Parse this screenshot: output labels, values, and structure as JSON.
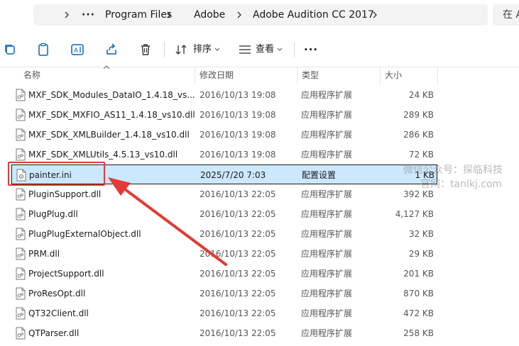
{
  "address": {
    "breadcrumb": [
      "Program Files",
      "Adobe",
      "Adobe Audition CC 2017"
    ],
    "more_glyph": "···",
    "search_placeholder": "在 A"
  },
  "toolbar": {
    "sort_label": "排序",
    "view_label": "查看",
    "more_glyph": "···"
  },
  "columns": {
    "name": "名称",
    "date": "修改日期",
    "type": "类型",
    "size": "大小"
  },
  "files": [
    {
      "name": "MXF_SDK_Modules_DataIO_1.4.18_vs...",
      "date": "2016/10/13 19:08",
      "type": "应用程序扩展",
      "size": "24 KB",
      "icon": "dll-file-icon"
    },
    {
      "name": "MXF_SDK_MXFIO_AS11_1.4.18_vs10.dll",
      "date": "2016/10/13 19:08",
      "type": "应用程序扩展",
      "size": "289 KB",
      "icon": "dll-file-icon"
    },
    {
      "name": "MXF_SDK_XMLBuilder_1.4.18_vs10.dll",
      "date": "2016/10/13 19:08",
      "type": "应用程序扩展",
      "size": "286 KB",
      "icon": "dll-file-icon"
    },
    {
      "name": "MXF_SDK_XMLUtils_4.5.13_vs10.dll",
      "date": "2016/10/13 19:08",
      "type": "应用程序扩展",
      "size": "72 KB",
      "icon": "dll-file-icon"
    },
    {
      "name": "painter.ini",
      "date": "2025/7/20 7:03",
      "type": "配置设置",
      "size": "1 KB",
      "icon": "ini-file-icon",
      "selected": true
    },
    {
      "name": "PluginSupport.dll",
      "date": "2016/10/13 22:05",
      "type": "应用程序扩展",
      "size": "392 KB",
      "icon": "dll-file-icon"
    },
    {
      "name": "PlugPlug.dll",
      "date": "2016/10/13 22:05",
      "type": "应用程序扩展",
      "size": "4,127 KB",
      "icon": "dll-file-icon"
    },
    {
      "name": "PlugPlugExternalObject.dll",
      "date": "2016/10/13 22:05",
      "type": "应用程序扩展",
      "size": "32 KB",
      "icon": "dll-file-icon"
    },
    {
      "name": "PRM.dll",
      "date": "2016/10/13 22:05",
      "type": "应用程序扩展",
      "size": "29 KB",
      "icon": "dll-file-icon"
    },
    {
      "name": "ProjectSupport.dll",
      "date": "2016/10/13 22:05",
      "type": "应用程序扩展",
      "size": "201 KB",
      "icon": "dll-file-icon"
    },
    {
      "name": "ProResOpt.dll",
      "date": "2016/10/13 22:05",
      "type": "应用程序扩展",
      "size": "870 KB",
      "icon": "dll-file-icon"
    },
    {
      "name": "QT32Client.dll",
      "date": "2016/10/13 22:05",
      "type": "应用程序扩展",
      "size": "472 KB",
      "icon": "dll-file-icon"
    },
    {
      "name": "QTParser.dll",
      "date": "2016/10/13 22:05",
      "type": "应用程序扩展",
      "size": "258 KB",
      "icon": "dll-file-icon"
    }
  ],
  "watermark": {
    "line1": "微信公众号：探临科技",
    "line2": "官网：tanlkj.com"
  },
  "colors": {
    "selection_bg": "#cce8ff",
    "annotation_red": "#e53935",
    "accent": "#0067c0"
  }
}
